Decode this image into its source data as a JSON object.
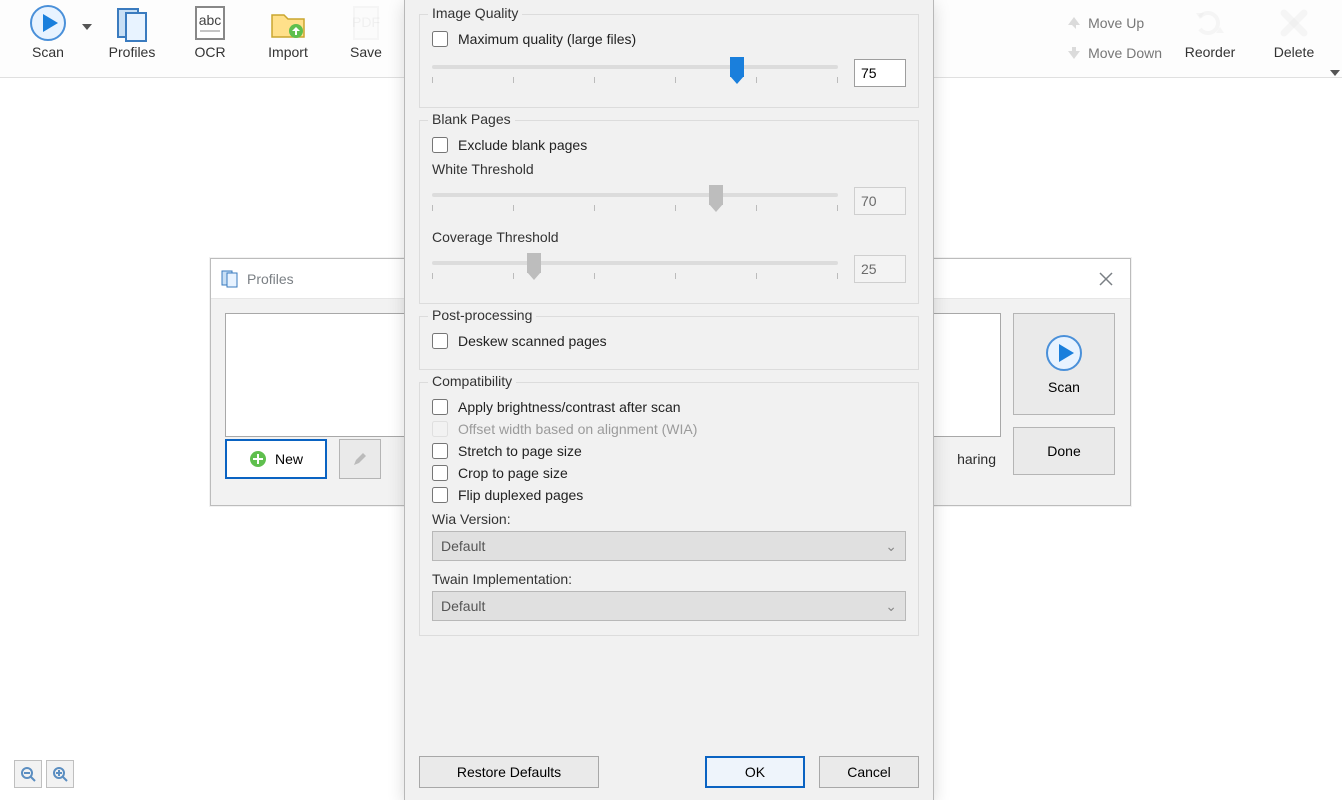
{
  "toolbar": {
    "scan": "Scan",
    "profiles": "Profiles",
    "ocr": "OCR",
    "import": "Import",
    "save": "Save",
    "move_up": "Move Up",
    "move_down": "Move Down",
    "reorder": "Reorder",
    "delete": "Delete"
  },
  "profiles_dialog": {
    "title": "Profiles",
    "new": "New",
    "scan": "Scan",
    "done": "Done",
    "sharing": "haring"
  },
  "advanced": {
    "image_quality": {
      "legend": "Image Quality",
      "max_quality": "Maximum quality (large files)",
      "value": "75",
      "slider_percent": 75
    },
    "blank_pages": {
      "legend": "Blank Pages",
      "exclude": "Exclude blank pages",
      "white_threshold_label": "White Threshold",
      "white_threshold_value": "70",
      "white_threshold_percent": 70,
      "coverage_threshold_label": "Coverage Threshold",
      "coverage_threshold_value": "25",
      "coverage_threshold_percent": 25
    },
    "post_processing": {
      "legend": "Post-processing",
      "deskew": "Deskew scanned pages"
    },
    "compatibility": {
      "legend": "Compatibility",
      "brightness": "Apply brightness/contrast after scan",
      "offset_wia": "Offset width based on alignment (WIA)",
      "stretch": "Stretch to page size",
      "crop": "Crop to page size",
      "flip": "Flip duplexed pages",
      "wia_version_label": "Wia Version:",
      "wia_version_value": "Default",
      "twain_label": "Twain Implementation:",
      "twain_value": "Default"
    },
    "footer": {
      "restore": "Restore Defaults",
      "ok": "OK",
      "cancel": "Cancel"
    }
  },
  "colors": {
    "accent": "#0a63c2"
  }
}
